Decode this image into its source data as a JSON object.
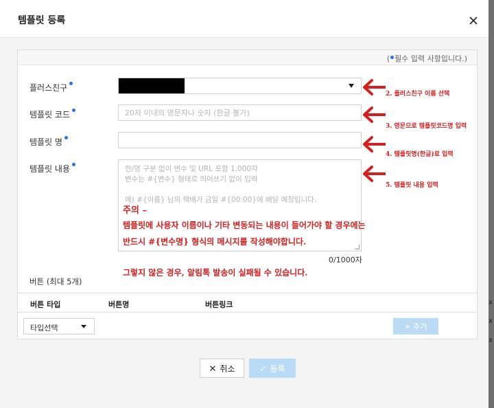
{
  "modal": {
    "title": "템플릿 등록",
    "required_note_prefix": "(",
    "required_note_text": "필수 입력 사항입니다.)"
  },
  "form": {
    "friend_label": "플러스친구",
    "code_label": "템플릿 코드",
    "code_placeholder": "20자 이내의 영문자나 숫자 (한글 불가)",
    "name_label": "템플릿 명",
    "content_label": "템플릿 내용",
    "content_placeholder_lines": [
      "한/영 구분 없이 변수 및 URL 포함 1,000자",
      "변수는 #{변수} 형태로 띄어쓰기 없이 입력",
      "",
      "예) #{이름} 님의 택배가 금일 #{00:00}에 배달 예정입니다."
    ],
    "char_count": "0/1000자",
    "buttons_label": "버튼 (최대 5개)",
    "table_headers": [
      "버튼 타입",
      "버튼명",
      "버튼링크"
    ],
    "type_select_value": "타입선택",
    "add_button": "+ 추가"
  },
  "footer": {
    "cancel_label": "취소",
    "register_label": "등록"
  },
  "annotations": {
    "step2": "2. 플러스친구 이름 선택",
    "step3": "3. 영문으로 템플릿코드명 입력",
    "step4": "4. 템플릿명(한글)로 입력",
    "step5": "5. 템플릿 내용 입력",
    "warning_title": "주의 –",
    "warning_line1": "템플릿에 사용자 이름이나 기타 변동되는 내용이 들어가야 할 경우에는",
    "warning_line2": "반드시 #{변수명} 형식의 메시지를 작성해야합니다.",
    "warning_line3": "그렇지 않은 경우, 알림톡 발송이 실패될 수 있습니다."
  },
  "colors": {
    "accent": "#2b71d9",
    "annotation": "#d61e1e",
    "disabled_button": "#b9dbf5"
  }
}
